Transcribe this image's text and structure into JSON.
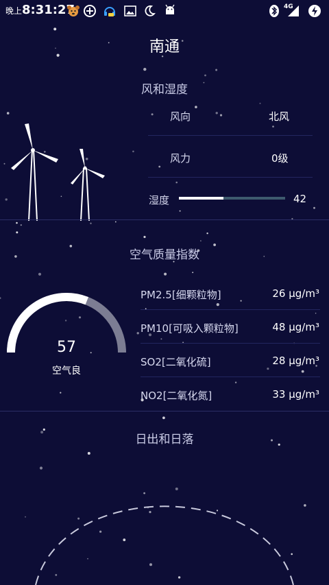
{
  "status_bar": {
    "period": "晚上",
    "time": "8:31:27",
    "network": "4G",
    "icons": [
      "dog-icon",
      "plus-circle-icon",
      "headset-icon",
      "image-icon",
      "moon-icon",
      "android-icon",
      "bluetooth-icon",
      "signal-icon",
      "battery-charging-icon"
    ]
  },
  "city": "南通",
  "wind_humidity": {
    "title": "风和湿度",
    "wind_direction_label": "风向",
    "wind_direction_value": "北风",
    "wind_force_label": "风力",
    "wind_force_value": "0级",
    "humidity_label": "湿度",
    "humidity_value": "42",
    "humidity_percent": 42
  },
  "air_quality": {
    "title": "空气质量指数",
    "aqi_value": "57",
    "aqi_text": "空气良",
    "gauge_fraction": 0.62,
    "items": [
      {
        "label": "PM2.5[细颗粒物]",
        "value": "26 μg/m³"
      },
      {
        "label": "PM10[可吸入颗粒物]",
        "value": "48 μg/m³"
      },
      {
        "label": "SO2[二氧化硫]",
        "value": "28 μg/m³"
      },
      {
        "label": "NO2[二氧化氮]",
        "value": "33 μg/m³"
      }
    ]
  },
  "sun": {
    "title": "日出和日落"
  },
  "colors": {
    "background": "#0d0d36",
    "accent_white": "#ffffff",
    "gauge_track": "#7c7d93",
    "humidity_track": "#3e5a6e"
  }
}
